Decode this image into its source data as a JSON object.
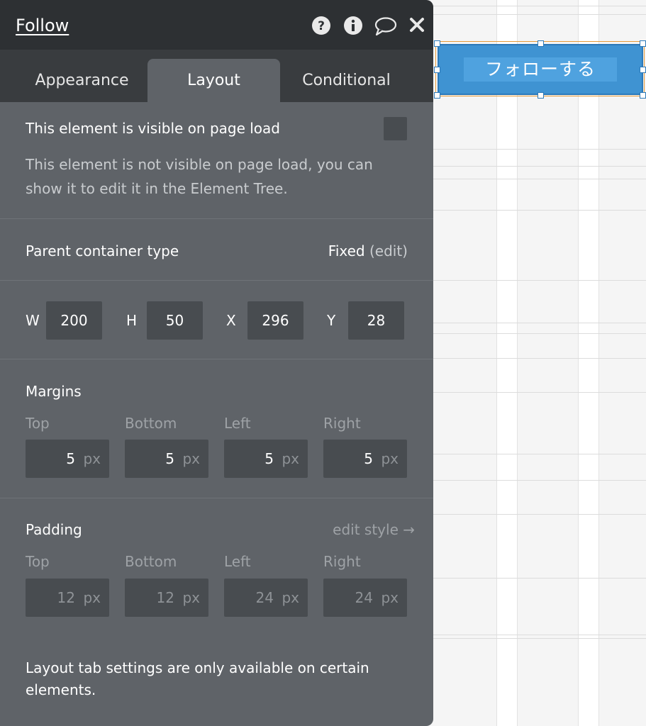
{
  "panel": {
    "title": "Follow",
    "tabs": [
      "Appearance",
      "Layout",
      "Conditional"
    ],
    "active_tab": "Layout",
    "visibility": {
      "label": "This element is visible on page load",
      "checked": false,
      "note_line1": "This element is not visible on page load, you can",
      "note_line2": "show it to edit it in the Element Tree."
    },
    "parent_container": {
      "label": "Parent container type",
      "value": "Fixed",
      "edit": "(edit)"
    },
    "dimensions": {
      "w_label": "W",
      "w": "200",
      "h_label": "H",
      "h": "50",
      "x_label": "X",
      "x": "296",
      "y_label": "Y",
      "y": "28"
    },
    "margins": {
      "title": "Margins",
      "top_label": "Top",
      "bottom_label": "Bottom",
      "left_label": "Left",
      "right_label": "Right",
      "top": "5",
      "bottom": "5",
      "left": "5",
      "right": "5",
      "unit": "px"
    },
    "padding": {
      "title": "Padding",
      "edit_style": "edit style →",
      "top_label": "Top",
      "bottom_label": "Bottom",
      "left_label": "Left",
      "right_label": "Right",
      "top": "12",
      "bottom": "12",
      "left": "24",
      "right": "24",
      "unit": "px"
    },
    "footer_line1": "Layout tab settings are only available on certain",
    "footer_line2": "elements."
  },
  "canvas": {
    "button_label": "フォローする"
  },
  "icons": [
    "help-icon",
    "info-icon",
    "comment-icon",
    "close-icon"
  ],
  "colors": {
    "panel_bg": "#5f6368",
    "header_bg": "#2d3033",
    "tabs_bg": "#393c3f",
    "input_bg": "#484c50",
    "button_blue": "#3f93d2",
    "selection_orange": "#e59b3a"
  }
}
